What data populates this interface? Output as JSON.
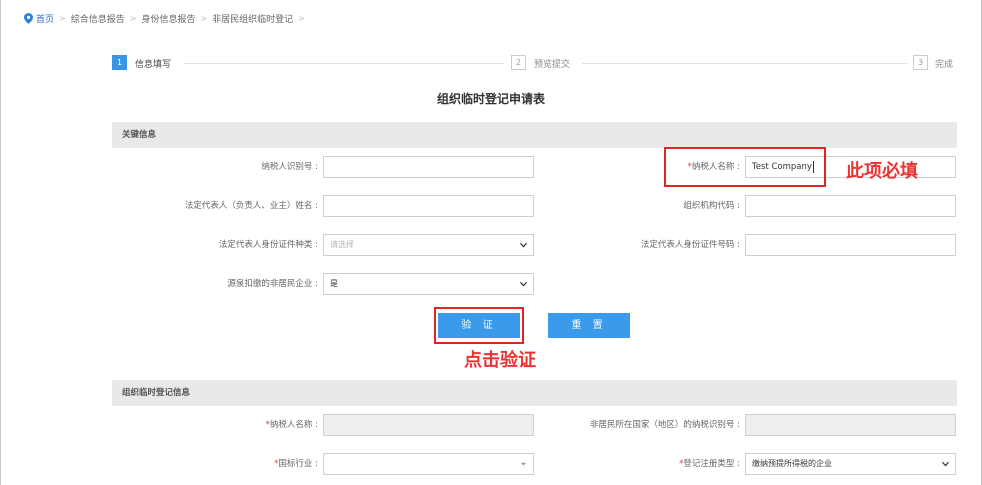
{
  "breadcrumb": {
    "items": [
      "首页",
      "综合信息报告",
      "身份信息报告",
      "非居民组织临时登记"
    ],
    "separator": ">"
  },
  "steps": [
    {
      "num": "1",
      "label": "信息填写",
      "active": true
    },
    {
      "num": "2",
      "label": "预览提交",
      "active": false
    },
    {
      "num": "3",
      "label": "完成",
      "active": false
    }
  ],
  "form_title": "组织临时登记申请表",
  "key_section": {
    "title": "关键信息",
    "taxpayer_id_label": "纳税人识别号 :",
    "taxpayer_id_value": "",
    "taxpayer_name_req": "*",
    "taxpayer_name_label": "纳税人名称 :",
    "taxpayer_name_value": "Test Company",
    "legal_rep_name_label": "法定代表人（负责人、业主）姓名 :",
    "org_code_label": "组织机构代码 :",
    "id_type_label": "法定代表人身份证件种类 :",
    "id_type_placeholder": "请选择",
    "id_number_label": "法定代表人身份证件号码 :",
    "withholding_label": "源泉扣缴的非居民企业 :",
    "withholding_value": "是",
    "verify_button": "验 证",
    "reset_button": "重 置"
  },
  "reg_section": {
    "title": "组织临时登记信息",
    "req": "*",
    "taxpayer_name_label": "纳税人名称 :",
    "foreign_tax_id_label": "非居民所在国家（地区）的纳税识别号 :",
    "industry_label": "国标行业 :",
    "reg_type_label": "登记注册类型 :",
    "reg_type_value": "缴纳预提所得税的企业"
  },
  "annotations": {
    "required_note": "此项必填",
    "click_note": "点击验证"
  },
  "colors": {
    "accent": "#3b9aea",
    "annotation_red": "#e02424",
    "required_red": "#e03a3a",
    "section_bg": "#e9e9e9"
  },
  "icons": {
    "home": "location-pin-icon",
    "dropdown": "chevron-down-icon"
  }
}
